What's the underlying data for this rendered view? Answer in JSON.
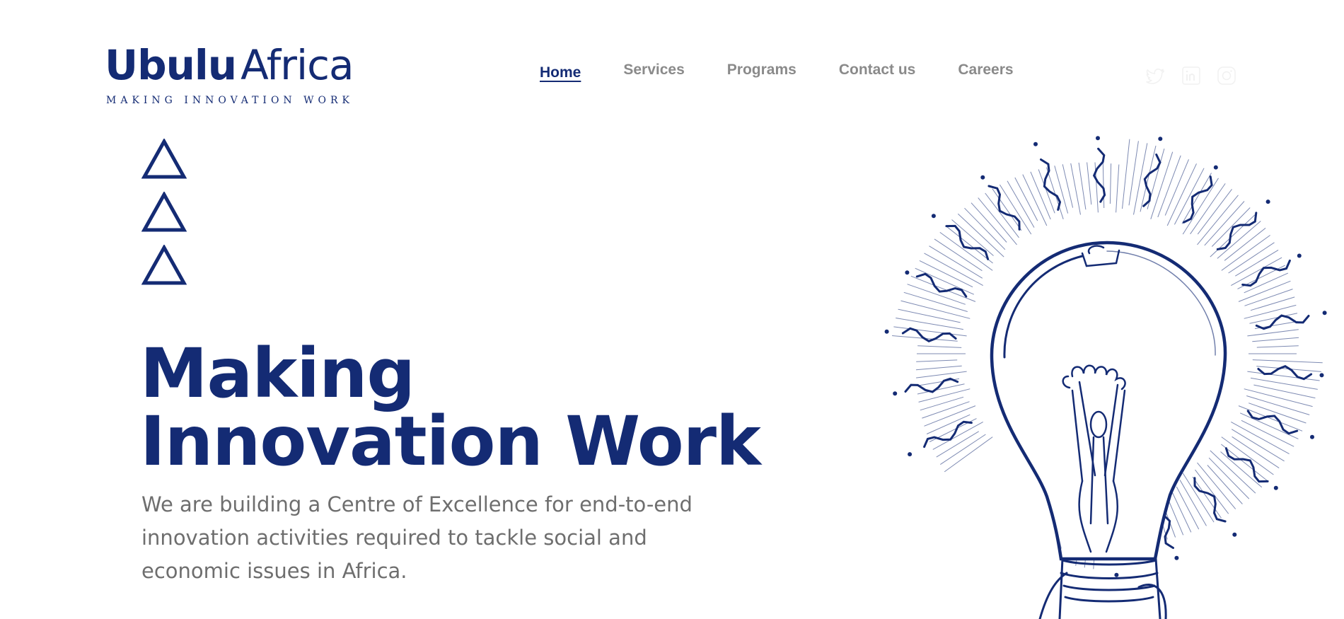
{
  "brand": {
    "name_bold": "Ubulu",
    "name_light": "Africa",
    "tagline": "MAKING INNOVATION WORK"
  },
  "nav": {
    "items": [
      {
        "label": "Home",
        "active": true
      },
      {
        "label": "Services",
        "active": false
      },
      {
        "label": "Programs",
        "active": false
      },
      {
        "label": "Contact us",
        "active": false
      },
      {
        "label": "Careers",
        "active": false
      }
    ]
  },
  "social": {
    "icons": [
      "twitter-icon",
      "linkedin-icon",
      "instagram-icon"
    ]
  },
  "hero": {
    "title_line1": "Making",
    "title_line2": "Innovation Work",
    "subtitle": "We are building a Centre of Excellence for end-to-end innovation activities required to tackle social and economic issues in Africa."
  },
  "colors": {
    "brand_blue": "#142b74",
    "nav_gray": "#8a8a8a",
    "text_gray": "#6e6e6e",
    "social_faint": "#f1f1f1"
  }
}
